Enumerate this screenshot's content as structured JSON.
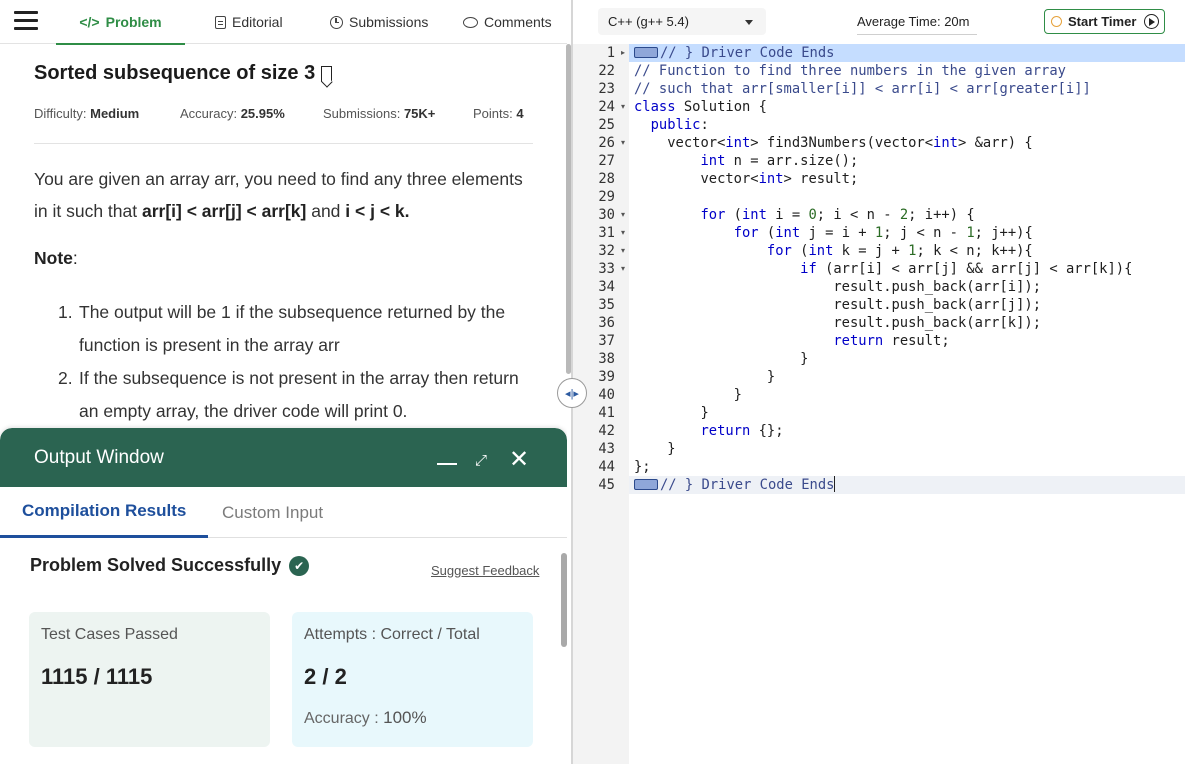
{
  "nav": {
    "tabs": [
      {
        "label": "Problem",
        "icon": "code-icon"
      },
      {
        "label": "Editorial",
        "icon": "document-icon"
      },
      {
        "label": "Submissions",
        "icon": "clock-icon"
      },
      {
        "label": "Comments",
        "icon": "comment-icon"
      }
    ],
    "problem_icon_glyph": "</>"
  },
  "problem": {
    "title": "Sorted subsequence of size 3",
    "difficulty_label": "Difficulty:",
    "difficulty": "Medium",
    "accuracy_label": "Accuracy:",
    "accuracy": "25.95%",
    "submissions_label": "Submissions:",
    "submissions": "75K+",
    "points_label": "Points:",
    "points": "4",
    "desc_1": "You are given an array arr, you need to find any three elements in it such that ",
    "desc_bold_1": "arr[i] < arr[j] < arr[k]",
    "desc_2": " and ",
    "desc_bold_2": "i < j < k.",
    "note_label": "Note",
    "note_colon": ":",
    "notes": [
      {
        "num": "1.",
        "text": "The output will be 1 if the subsequence returned by the function is present in the array arr"
      },
      {
        "num": "2.",
        "text": "If the subsequence is not present in the array then return an empty array, the driver code will print 0."
      }
    ]
  },
  "output": {
    "title": "Output Window",
    "tabs": [
      "Compilation Results",
      "Custom Input"
    ],
    "status": "Problem Solved Successfully",
    "feedback": "Suggest Feedback",
    "test_cases_label": "Test Cases Passed",
    "test_cases_value": "1115 / 1115",
    "attempts_label": "Attempts : Correct / Total",
    "attempts_value": "2 / 2",
    "accuracy_label": "Accuracy :",
    "accuracy_value": "100%"
  },
  "editor": {
    "language": "C++ (g++ 5.4)",
    "avg_time": "Average Time: 20m",
    "timer_label": "Start Timer",
    "lines": [
      {
        "n": "1",
        "fold": "▸",
        "hl": "blue",
        "html": "<span class=\"fold-marker\"></span><span class=\"cm\">// } Driver Code Ends</span>"
      },
      {
        "n": "22",
        "fold": "",
        "html": "<span class=\"cm\">// Function to find three numbers in the given array</span>"
      },
      {
        "n": "23",
        "fold": "",
        "html": "<span class=\"cm\">// such that arr[smaller[i]] &lt; arr[i] &lt; arr[greater[i]]</span>"
      },
      {
        "n": "24",
        "fold": "▾",
        "html": "<span class=\"k\">class</span> Solution {"
      },
      {
        "n": "25",
        "fold": "",
        "html": "  <span class=\"k\">public</span>:"
      },
      {
        "n": "26",
        "fold": "▾",
        "html": "    vector&lt;<span class=\"k\">int</span>&gt; find3Numbers(vector&lt;<span class=\"k\">int</span>&gt; &amp;arr) {"
      },
      {
        "n": "27",
        "fold": "",
        "html": "        <span class=\"k\">int</span> n = arr.size();"
      },
      {
        "n": "28",
        "fold": "",
        "html": "        vector&lt;<span class=\"k\">int</span>&gt; result;"
      },
      {
        "n": "29",
        "fold": "",
        "html": ""
      },
      {
        "n": "30",
        "fold": "▾",
        "html": "        <span class=\"k\">for</span> (<span class=\"k\">int</span> i = <span class=\"c\">0</span>; i &lt; n - <span class=\"c\">2</span>; i++) {"
      },
      {
        "n": "31",
        "fold": "▾",
        "html": "            <span class=\"k\">for</span> (<span class=\"k\">int</span> j = i + <span class=\"c\">1</span>; j &lt; n - <span class=\"c\">1</span>; j++){"
      },
      {
        "n": "32",
        "fold": "▾",
        "html": "                <span class=\"k\">for</span> (<span class=\"k\">int</span> k = j + <span class=\"c\">1</span>; k &lt; n; k++){"
      },
      {
        "n": "33",
        "fold": "▾",
        "html": "                    <span class=\"k\">if</span> (arr[i] &lt; arr[j] &amp;&amp; arr[j] &lt; arr[k]){"
      },
      {
        "n": "34",
        "fold": "",
        "html": "                        result.push_back(arr[i]);"
      },
      {
        "n": "35",
        "fold": "",
        "html": "                        result.push_back(arr[j]);"
      },
      {
        "n": "36",
        "fold": "",
        "html": "                        result.push_back(arr[k]);"
      },
      {
        "n": "37",
        "fold": "",
        "html": "                        <span class=\"k\">return</span> result;"
      },
      {
        "n": "38",
        "fold": "",
        "html": "                    }"
      },
      {
        "n": "39",
        "fold": "",
        "html": "                }"
      },
      {
        "n": "40",
        "fold": "",
        "html": "            }"
      },
      {
        "n": "41",
        "fold": "",
        "html": "        }"
      },
      {
        "n": "42",
        "fold": "",
        "html": "        <span class=\"k\">return</span> {};"
      },
      {
        "n": "43",
        "fold": "",
        "html": "    }"
      },
      {
        "n": "44",
        "fold": "",
        "html": "};"
      },
      {
        "n": "45",
        "fold": "",
        "hl": "grey",
        "html": "<span class=\"fold-marker\"></span><span class=\"cm\">// } Driver Code Ends</span><span class=\"cursor\"></span>"
      }
    ]
  },
  "colors": {
    "accent_green": "#2f8d46",
    "output_header": "#2b6451",
    "link_blue": "#1e4f9c"
  }
}
